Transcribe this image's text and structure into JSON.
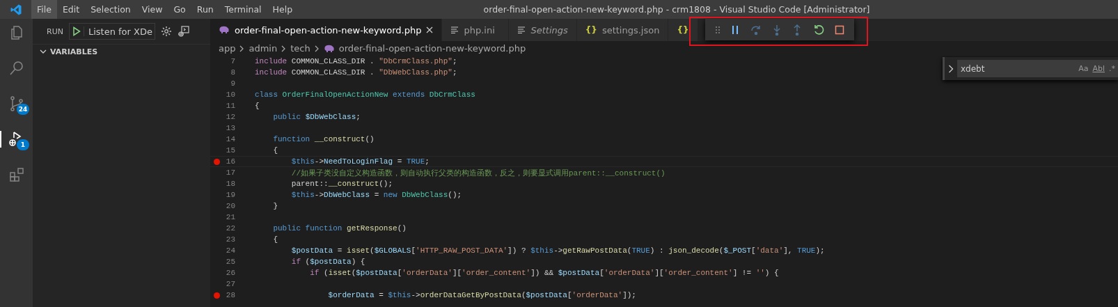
{
  "menu": [
    {
      "label": "File",
      "selected": true
    },
    {
      "label": "Edit",
      "selected": false
    },
    {
      "label": "Selection",
      "selected": false
    },
    {
      "label": "View",
      "selected": false
    },
    {
      "label": "Go",
      "selected": false
    },
    {
      "label": "Run",
      "selected": false
    },
    {
      "label": "Terminal",
      "selected": false
    },
    {
      "label": "Help",
      "selected": false
    }
  ],
  "window": {
    "title": "order-final-open-action-new-keyword.php - crm1808 - Visual Studio Code [Administrator]"
  },
  "activity_bar": [
    {
      "kind": "files",
      "selected": false
    },
    {
      "kind": "search",
      "selected": false
    },
    {
      "kind": "source-control",
      "badge": "24",
      "selected": false
    },
    {
      "kind": "debug",
      "badge": "1",
      "selected": true
    },
    {
      "kind": "extensions",
      "selected": false
    }
  ],
  "sidebar": {
    "title": "RUN",
    "configuration": "Listen for XDe",
    "sections": [
      {
        "title": "VARIABLES",
        "expanded": true
      }
    ]
  },
  "tabs": [
    {
      "kind": "php",
      "label": "order-final-open-action-new-keyword.php",
      "selected": true
    },
    {
      "kind": "text",
      "label": "php.ini",
      "selected": false
    },
    {
      "kind": "text",
      "label": "Settings",
      "selected": false,
      "italic": true
    },
    {
      "kind": "json",
      "glyph": "{}",
      "label": "settings.json",
      "selected": false
    },
    {
      "kind": "json",
      "glyph": "{}",
      "selected": false
    }
  ],
  "breadcrumb": {
    "folders": [
      "app",
      "admin",
      "tech"
    ],
    "file": "order-final-open-action-new-keyword.php"
  },
  "debug_toolbar": [
    {
      "kind": "grip"
    },
    {
      "kind": "pause"
    },
    {
      "kind": "step-over"
    },
    {
      "kind": "step-into"
    },
    {
      "kind": "step-out"
    },
    {
      "kind": "restart"
    },
    {
      "kind": "stop"
    }
  ],
  "editor": {
    "lines": [
      {
        "number": "7",
        "breakpoint": false,
        "current": false,
        "tokens": [
          {
            "kind": "control",
            "text": "include"
          },
          {
            "kind": "plain",
            "text": " COMMON_CLASS_DIR . "
          },
          {
            "kind": "string",
            "text": "\"DbCrmClass.php\""
          },
          {
            "kind": "plain",
            "text": ";"
          }
        ]
      },
      {
        "number": "8",
        "breakpoint": false,
        "current": false,
        "tokens": [
          {
            "kind": "control",
            "text": "include"
          },
          {
            "kind": "plain",
            "text": " COMMON_CLASS_DIR . "
          },
          {
            "kind": "string",
            "text": "\"DbWebClass.php\""
          },
          {
            "kind": "plain",
            "text": ";"
          }
        ]
      },
      {
        "number": "9",
        "breakpoint": false,
        "current": false
      },
      {
        "number": "10",
        "breakpoint": false,
        "current": false,
        "tokens": [
          {
            "kind": "keyword",
            "text": "class "
          },
          {
            "kind": "type",
            "text": "OrderFinalOpenActionNew "
          },
          {
            "kind": "keyword",
            "text": "extends "
          },
          {
            "kind": "type",
            "text": "DbCrmClass"
          }
        ]
      },
      {
        "number": "11",
        "breakpoint": false,
        "current": false,
        "tokens": [
          {
            "kind": "plain",
            "text": "{"
          }
        ]
      },
      {
        "number": "12",
        "breakpoint": false,
        "current": false,
        "tokens": [
          {
            "kind": "keyword",
            "text": "    public "
          },
          {
            "kind": "variable",
            "text": "$DbWebClass"
          },
          {
            "kind": "plain",
            "text": ";"
          }
        ]
      },
      {
        "number": "13",
        "breakpoint": false,
        "current": false
      },
      {
        "number": "14",
        "breakpoint": false,
        "current": false,
        "tokens": [
          {
            "kind": "keyword",
            "text": "    function "
          },
          {
            "kind": "function",
            "text": "__construct"
          },
          {
            "kind": "plain",
            "text": "()"
          }
        ]
      },
      {
        "number": "15",
        "breakpoint": false,
        "current": false,
        "tokens": [
          {
            "kind": "plain",
            "text": "    {"
          }
        ]
      },
      {
        "number": "16",
        "breakpoint": true,
        "current": true,
        "tokens": [
          {
            "kind": "keyword",
            "text": "        $this"
          },
          {
            "kind": "plain",
            "text": "->"
          },
          {
            "kind": "variable",
            "text": "NeedToLoginFlag"
          },
          {
            "kind": "plain",
            "text": " = "
          },
          {
            "kind": "keyword",
            "text": "TRUE"
          },
          {
            "kind": "plain",
            "text": ";"
          }
        ]
      },
      {
        "number": "17",
        "breakpoint": false,
        "current": false,
        "tokens": [
          {
            "kind": "comment",
            "text": "        //如果子类没自定义构造函数，则自动执行父类的构造函数，反之，则要显式调用parent::__construct()"
          }
        ]
      },
      {
        "number": "18",
        "breakpoint": false,
        "current": false,
        "tokens": [
          {
            "kind": "plain",
            "text": "        parent::"
          },
          {
            "kind": "function",
            "text": "__construct"
          },
          {
            "kind": "plain",
            "text": "();"
          }
        ]
      },
      {
        "number": "19",
        "breakpoint": false,
        "current": false,
        "tokens": [
          {
            "kind": "keyword",
            "text": "        $this"
          },
          {
            "kind": "plain",
            "text": "->"
          },
          {
            "kind": "variable",
            "text": "DbWebClass"
          },
          {
            "kind": "plain",
            "text": " = "
          },
          {
            "kind": "keyword",
            "text": "new "
          },
          {
            "kind": "type",
            "text": "DbWebClass"
          },
          {
            "kind": "plain",
            "text": "();"
          }
        ]
      },
      {
        "number": "20",
        "breakpoint": false,
        "current": false,
        "tokens": [
          {
            "kind": "plain",
            "text": "    }"
          }
        ]
      },
      {
        "number": "21",
        "breakpoint": false,
        "current": false
      },
      {
        "number": "22",
        "breakpoint": false,
        "current": false,
        "tokens": [
          {
            "kind": "keyword",
            "text": "    public function "
          },
          {
            "kind": "function",
            "text": "getResponse"
          },
          {
            "kind": "plain",
            "text": "()"
          }
        ]
      },
      {
        "number": "23",
        "breakpoint": false,
        "current": false,
        "tokens": [
          {
            "kind": "plain",
            "text": "    {"
          }
        ]
      },
      {
        "number": "24",
        "breakpoint": false,
        "current": false,
        "tokens": [
          {
            "kind": "variable",
            "text": "        $postData"
          },
          {
            "kind": "plain",
            "text": " = "
          },
          {
            "kind": "function",
            "text": "isset"
          },
          {
            "kind": "plain",
            "text": "("
          },
          {
            "kind": "variable",
            "text": "$GLOBALS"
          },
          {
            "kind": "plain",
            "text": "["
          },
          {
            "kind": "string",
            "text": "'HTTP_RAW_POST_DATA'"
          },
          {
            "kind": "plain",
            "text": "]) ? "
          },
          {
            "kind": "keyword",
            "text": "$this"
          },
          {
            "kind": "plain",
            "text": "->"
          },
          {
            "kind": "function",
            "text": "getRawPostData"
          },
          {
            "kind": "plain",
            "text": "("
          },
          {
            "kind": "keyword",
            "text": "TRUE"
          },
          {
            "kind": "plain",
            "text": ") : "
          },
          {
            "kind": "function",
            "text": "json_decode"
          },
          {
            "kind": "plain",
            "text": "("
          },
          {
            "kind": "variable",
            "text": "$_POST"
          },
          {
            "kind": "plain",
            "text": "["
          },
          {
            "kind": "string",
            "text": "'data'"
          },
          {
            "kind": "plain",
            "text": "], "
          },
          {
            "kind": "keyword",
            "text": "TRUE"
          },
          {
            "kind": "plain",
            "text": ");"
          }
        ]
      },
      {
        "number": "25",
        "breakpoint": false,
        "current": false,
        "tokens": [
          {
            "kind": "control",
            "text": "        if"
          },
          {
            "kind": "plain",
            "text": " ("
          },
          {
            "kind": "variable",
            "text": "$postData"
          },
          {
            "kind": "plain",
            "text": ") {"
          }
        ]
      },
      {
        "number": "26",
        "breakpoint": false,
        "current": false,
        "tokens": [
          {
            "kind": "control",
            "text": "            if"
          },
          {
            "kind": "plain",
            "text": " ("
          },
          {
            "kind": "function",
            "text": "isset"
          },
          {
            "kind": "plain",
            "text": "("
          },
          {
            "kind": "variable",
            "text": "$postData"
          },
          {
            "kind": "plain",
            "text": "["
          },
          {
            "kind": "string",
            "text": "'orderData'"
          },
          {
            "kind": "plain",
            "text": "]["
          },
          {
            "kind": "string",
            "text": "'order_content'"
          },
          {
            "kind": "plain",
            "text": "]) && "
          },
          {
            "kind": "variable",
            "text": "$postData"
          },
          {
            "kind": "plain",
            "text": "["
          },
          {
            "kind": "string",
            "text": "'orderData'"
          },
          {
            "kind": "plain",
            "text": "]["
          },
          {
            "kind": "string",
            "text": "'order_content'"
          },
          {
            "kind": "plain",
            "text": "] != "
          },
          {
            "kind": "string",
            "text": "''"
          },
          {
            "kind": "plain",
            "text": ") {"
          }
        ]
      },
      {
        "number": "27",
        "breakpoint": false,
        "current": false
      },
      {
        "number": "28",
        "breakpoint": true,
        "current": false,
        "tokens": [
          {
            "kind": "variable",
            "text": "                $orderData"
          },
          {
            "kind": "plain",
            "text": " = "
          },
          {
            "kind": "keyword",
            "text": "$this"
          },
          {
            "kind": "plain",
            "text": "->"
          },
          {
            "kind": "function",
            "text": "orderDataGetByPostData"
          },
          {
            "kind": "plain",
            "text": "("
          },
          {
            "kind": "variable",
            "text": "$postData"
          },
          {
            "kind": "plain",
            "text": "["
          },
          {
            "kind": "string",
            "text": "'orderData'"
          },
          {
            "kind": "plain",
            "text": "]);"
          }
        ]
      }
    ]
  },
  "find_widget": {
    "value": "xdebt",
    "options": [
      "Aa",
      "Abl",
      ".*"
    ]
  }
}
